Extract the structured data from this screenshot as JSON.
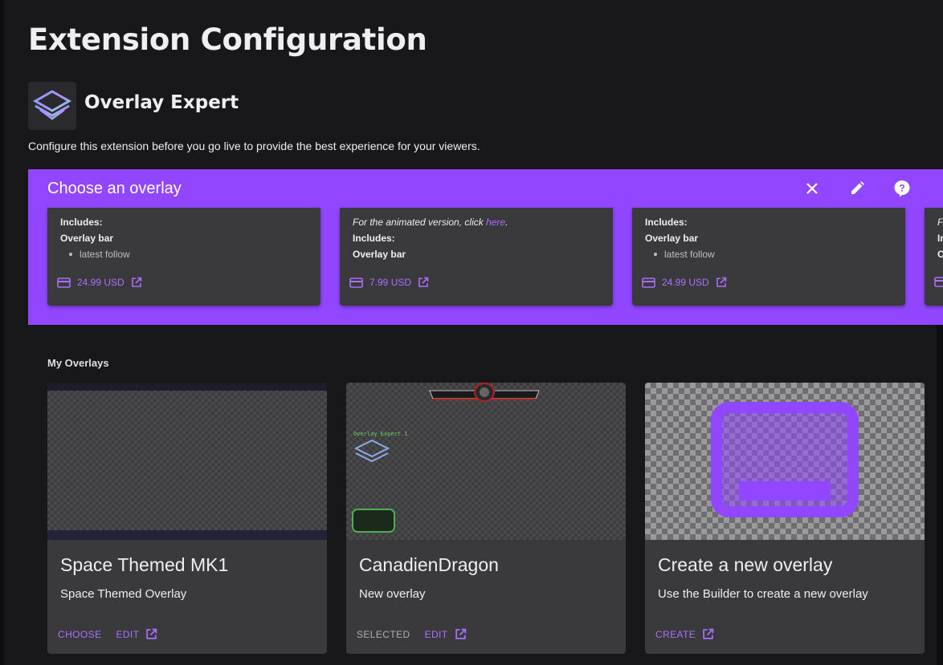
{
  "page": {
    "title": "Extension Configuration"
  },
  "extension": {
    "name": "Overlay Expert",
    "description": "Configure this extension before you go live to provide the best experience for your viewers.",
    "logo_icon": "overlay-expert-logo-icon"
  },
  "chooser": {
    "title": "Choose an overlay",
    "icons": [
      "close-icon",
      "pencil-icon",
      "help-icon"
    ],
    "cards": [
      {
        "intro": "",
        "includes": "Includes:",
        "section": "Overlay bar",
        "bullets": [
          "latest follow"
        ],
        "price": "24.99 USD"
      },
      {
        "intro_prefix": "For the animated version, click ",
        "intro_link": "here",
        "intro_suffix": ".",
        "includes": "Includes:",
        "section": "Overlay bar",
        "bullets": [],
        "price": "7.99 USD"
      },
      {
        "intro": "",
        "includes": "Includes:",
        "section": "Overlay bar",
        "bullets": [
          "latest follow"
        ],
        "price": "24.99 USD"
      },
      {
        "intro_prefix": "F",
        "includes": "In",
        "section": "O",
        "price": ""
      }
    ]
  },
  "my_overlays": {
    "label": "My Overlays",
    "cards": [
      {
        "title": "Space Themed MK1",
        "subtitle": "Space Themed Overlay",
        "actions": [
          "CHOOSE",
          "EDIT"
        ]
      },
      {
        "title": "CanadienDragon",
        "subtitle": "New overlay",
        "actions": [
          "SELECTED",
          "EDIT"
        ],
        "thumb_label": "Overlay Expert 1"
      },
      {
        "title": "Create a new overlay",
        "subtitle": "Use the Builder to create a new overlay",
        "actions": [
          "CREATE"
        ]
      }
    ]
  },
  "colors": {
    "accent": "#9147ff",
    "link": "#a970ff",
    "background": "#18181b",
    "card": "#3a3a3d"
  }
}
